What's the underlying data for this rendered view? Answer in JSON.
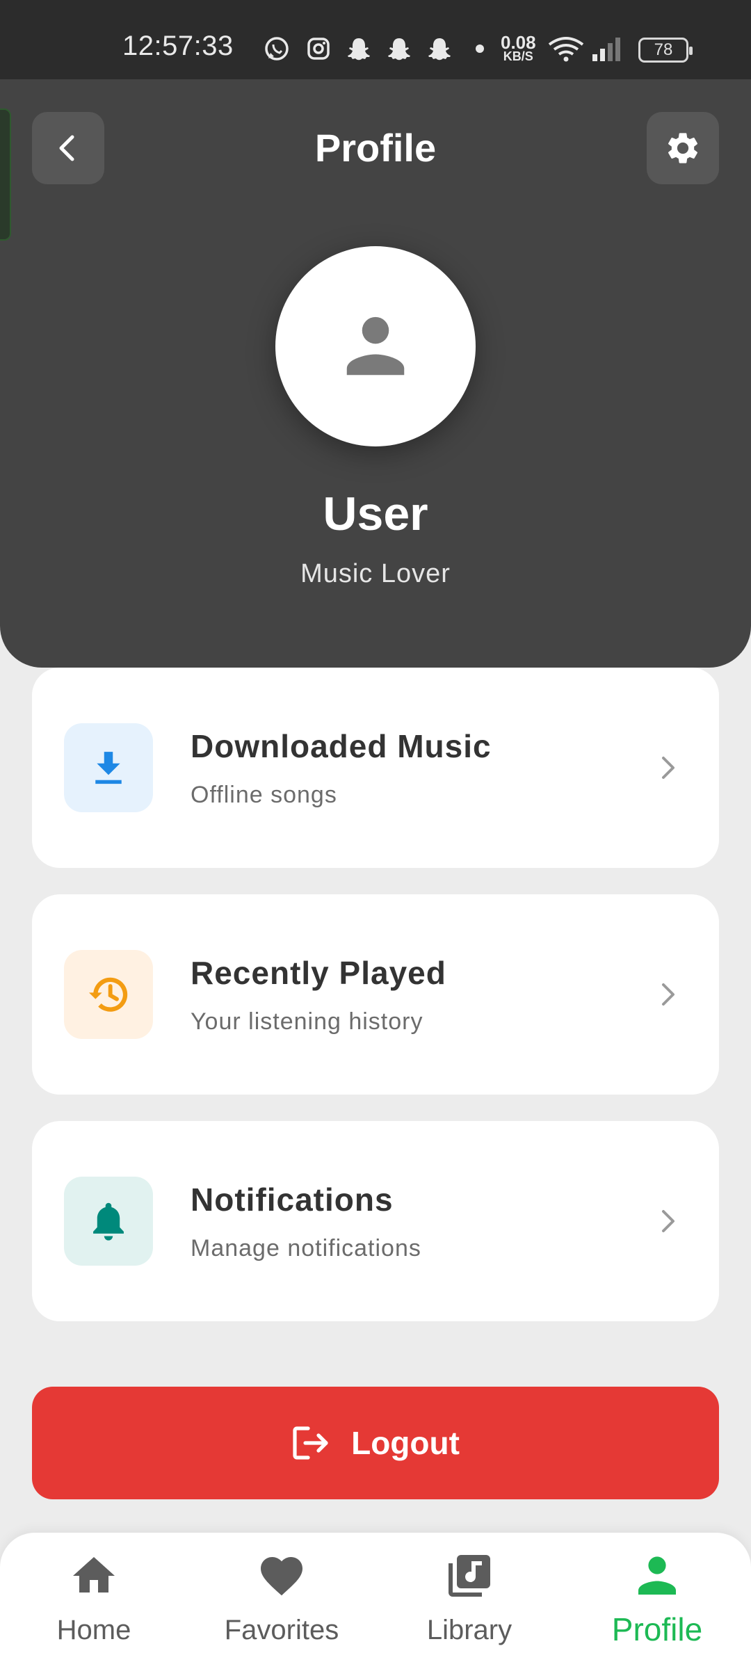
{
  "status_bar": {
    "time": "12:57:33",
    "net_speed": "0.08",
    "net_unit": "KB/S",
    "battery": "78",
    "icons": [
      "whatsapp-icon",
      "instagram-icon",
      "snapchat-icon",
      "snapchat-icon",
      "snapchat-icon",
      "dot-icon",
      "wifi-icon",
      "signal-icon",
      "battery-icon"
    ]
  },
  "header": {
    "title": "Profile",
    "back_icon": "chevron-left-icon",
    "settings_icon": "gear-icon"
  },
  "user": {
    "name": "User",
    "subtitle": "Music Lover",
    "avatar_icon": "person-icon"
  },
  "menu": [
    {
      "title": "Downloaded Music",
      "subtitle": "Offline songs",
      "icon": "download-icon",
      "icon_color": "#1e88e5",
      "icon_bg": "#e6f2fd"
    },
    {
      "title": "Recently Played",
      "subtitle": "Your listening history",
      "icon": "history-icon",
      "icon_color": "#f39c12",
      "icon_bg": "#fff1e2"
    },
    {
      "title": "Notifications",
      "subtitle": "Manage notifications",
      "icon": "bell-icon",
      "icon_color": "#00897b",
      "icon_bg": "#e1f2f0"
    }
  ],
  "logout": {
    "label": "Logout",
    "color": "#e53935"
  },
  "bottom_nav": {
    "items": [
      {
        "label": "Home",
        "icon": "home-icon"
      },
      {
        "label": "Favorites",
        "icon": "heart-icon"
      },
      {
        "label": "Library",
        "icon": "library-music-icon"
      },
      {
        "label": "Profile",
        "icon": "person-icon"
      }
    ],
    "active": "Profile",
    "active_color": "#1db954"
  }
}
